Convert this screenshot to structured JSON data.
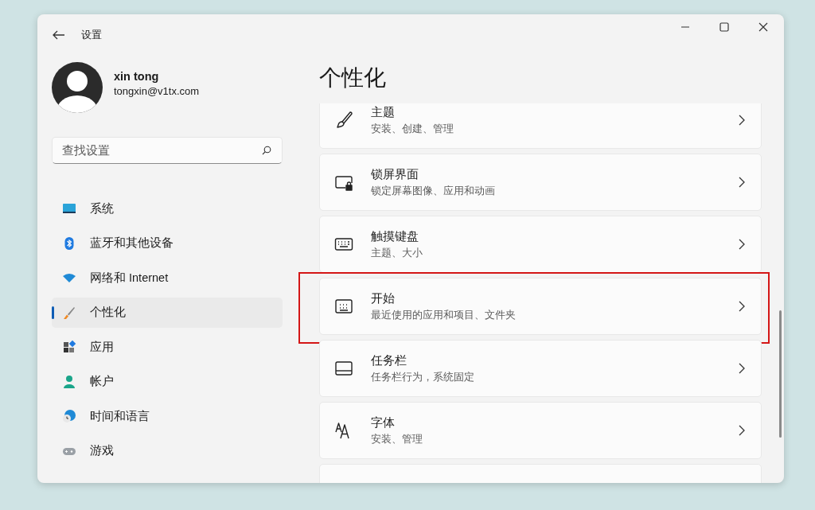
{
  "window": {
    "title": "设置"
  },
  "account": {
    "name": "xin tong",
    "email": "tongxin@v1tx.com"
  },
  "search": {
    "placeholder": "查找设置"
  },
  "sidebar": {
    "items": [
      {
        "label": "系统",
        "kind": "system",
        "selected": false
      },
      {
        "label": "蓝牙和其他设备",
        "kind": "bluetooth",
        "selected": false
      },
      {
        "label": "网络和 Internet",
        "kind": "network",
        "selected": false
      },
      {
        "label": "个性化",
        "kind": "personalize",
        "selected": true
      },
      {
        "label": "应用",
        "kind": "apps",
        "selected": false
      },
      {
        "label": "帐户",
        "kind": "account",
        "selected": false
      },
      {
        "label": "时间和语言",
        "kind": "time",
        "selected": false
      },
      {
        "label": "游戏",
        "kind": "gaming",
        "selected": false
      }
    ]
  },
  "page": {
    "title": "个性化",
    "cards": [
      {
        "kind": "brush",
        "title": "主题",
        "subtitle": "安装、创建、管理",
        "highlighted": false
      },
      {
        "kind": "lock",
        "title": "锁屏界面",
        "subtitle": "锁定屏幕图像、应用和动画",
        "highlighted": false
      },
      {
        "kind": "keyboard",
        "title": "触摸键盘",
        "subtitle": "主题、大小",
        "highlighted": false
      },
      {
        "kind": "start",
        "title": "开始",
        "subtitle": "最近使用的应用和项目、文件夹",
        "highlighted": true
      },
      {
        "kind": "taskbar",
        "title": "任务栏",
        "subtitle": "任务栏行为，系统固定",
        "highlighted": false
      },
      {
        "kind": "fonts",
        "title": "字体",
        "subtitle": "安装、管理",
        "highlighted": false
      },
      {
        "highlighted": false
      }
    ]
  }
}
